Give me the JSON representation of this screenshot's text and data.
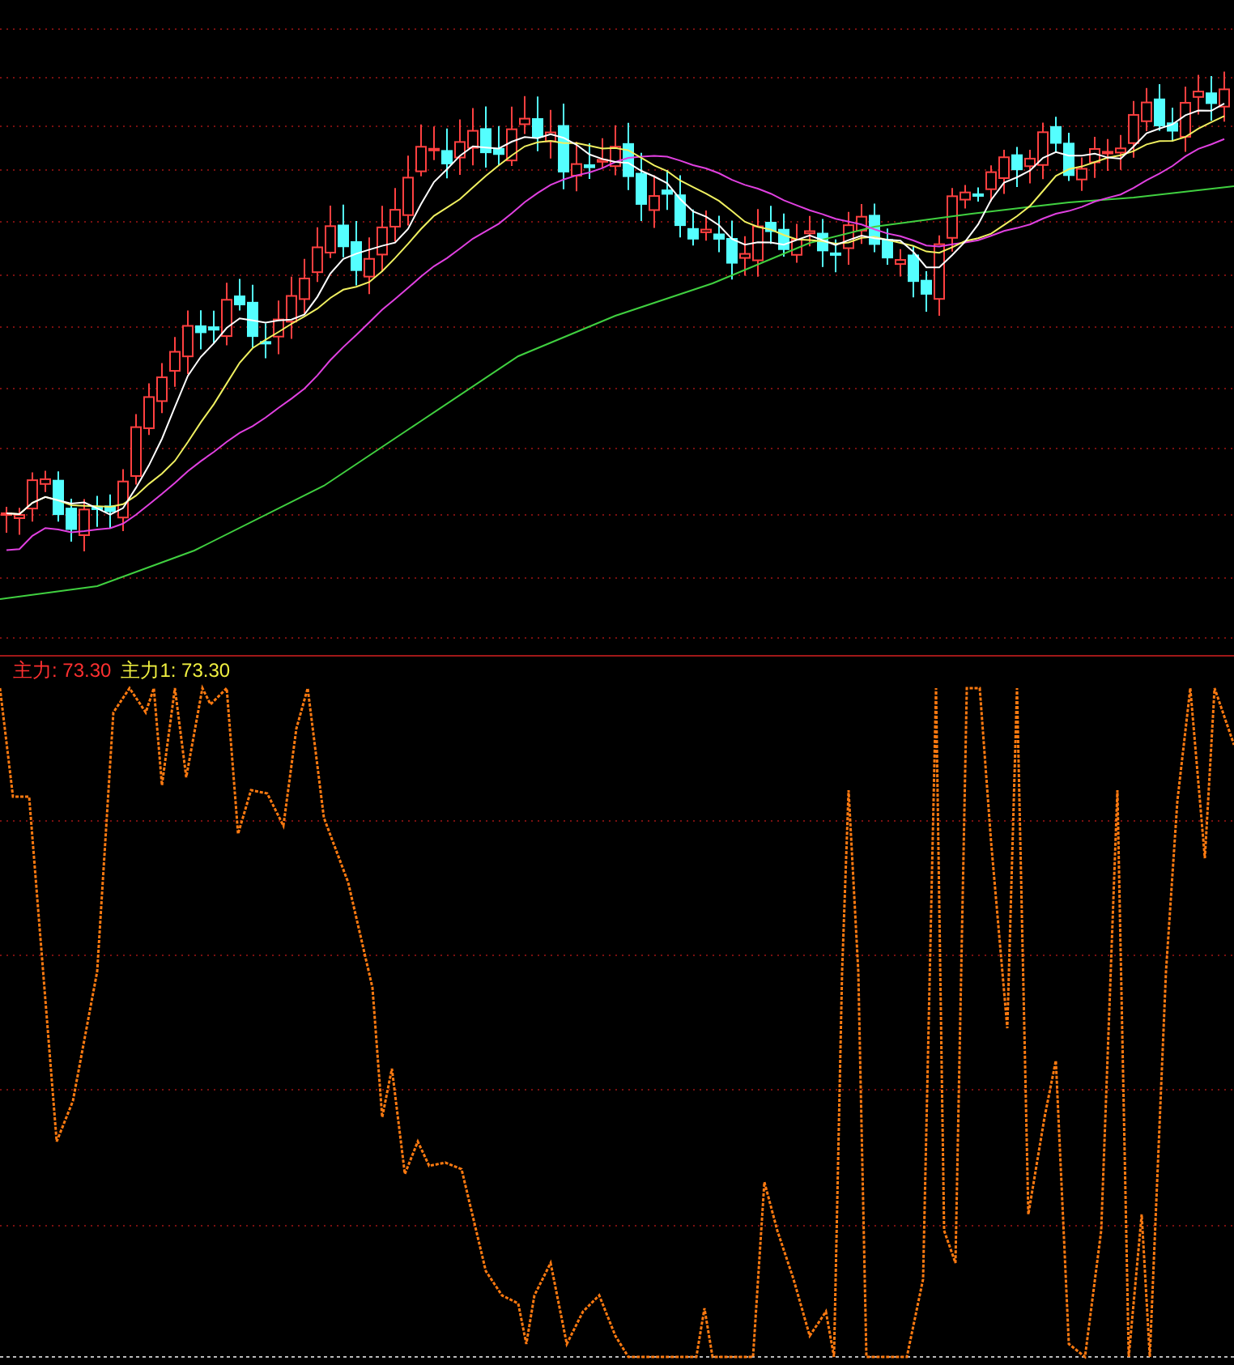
{
  "indicator_panel": {
    "legend": [
      {
        "text": "主力: 73.30",
        "color": "#ff3030"
      },
      {
        "text": "主力1: 73.30",
        "color": "#f0f040"
      }
    ]
  }
}
